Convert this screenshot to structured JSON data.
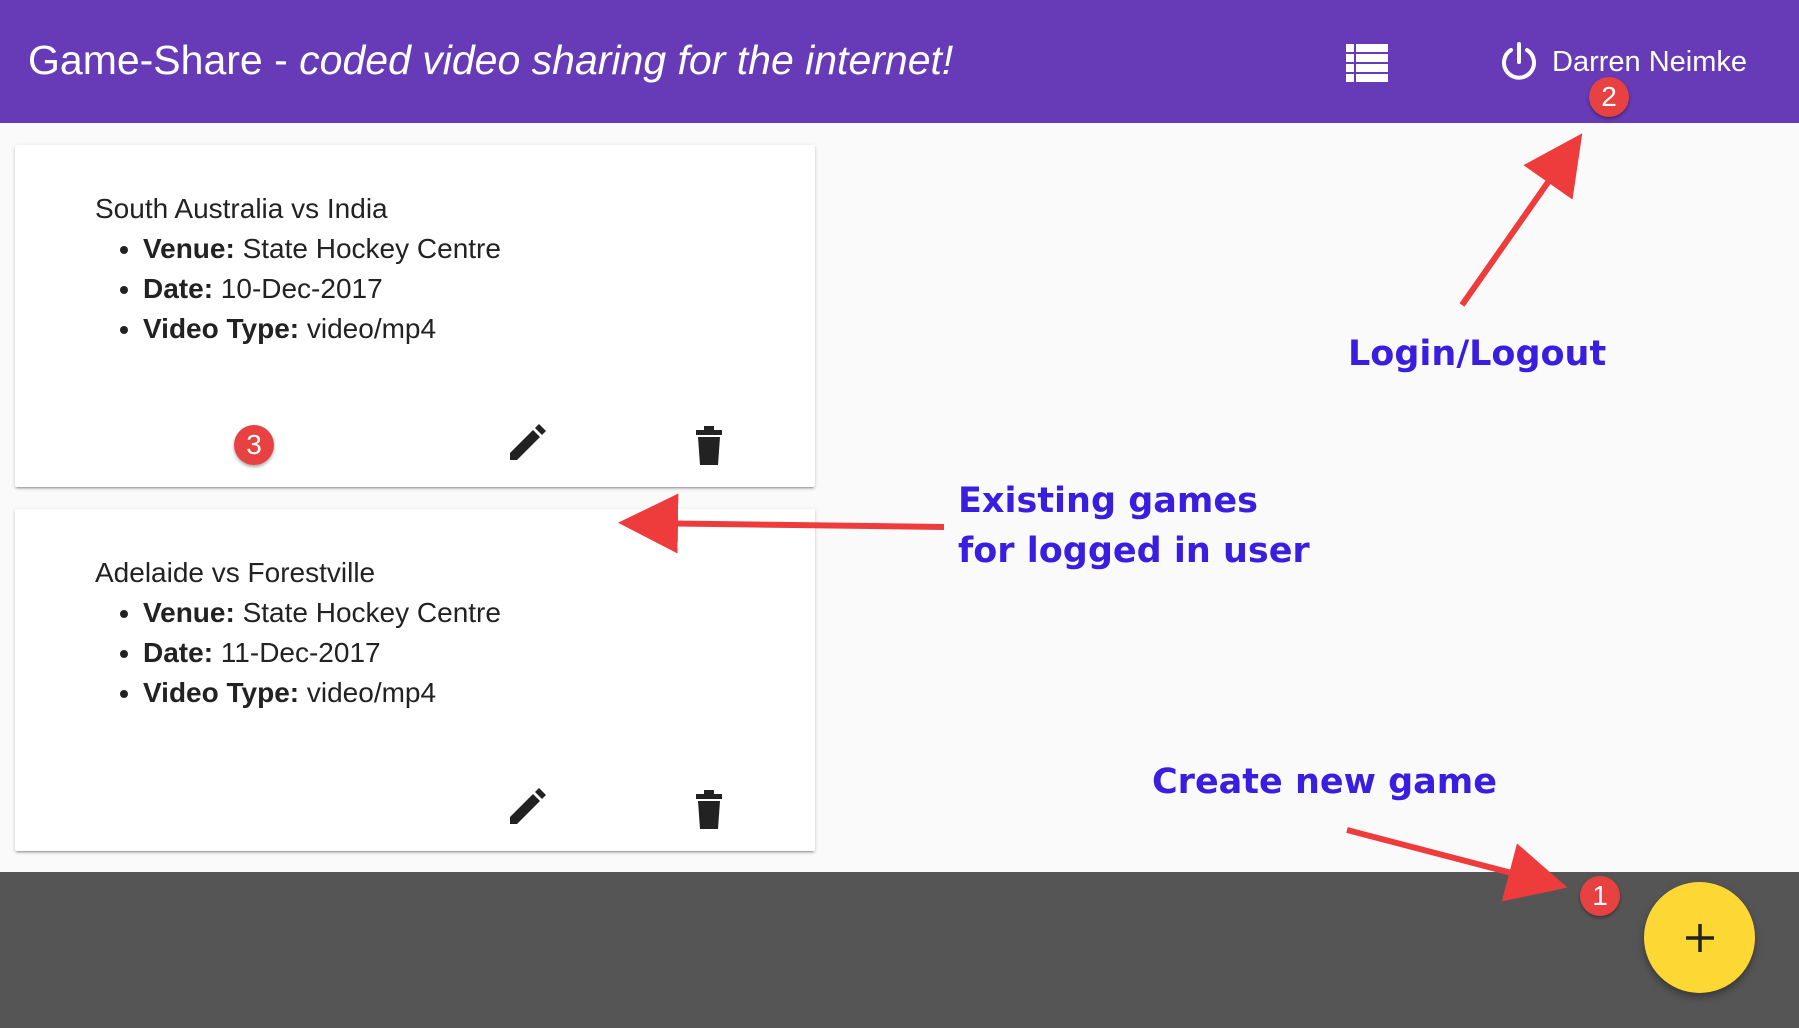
{
  "app": {
    "title_prefix": "Game-Share - ",
    "title_tagline": "coded video sharing for the internet!",
    "user_name": "Darren Neimke",
    "icons": [
      "list-icon",
      "power-icon",
      "edit-icon",
      "delete-icon",
      "add-icon"
    ],
    "colors": {
      "toolbar": "#673ab7",
      "fab": "#fdd835",
      "footer": "#555555",
      "badge": "#e84141",
      "callout": "#3a1ee0"
    }
  },
  "labels": {
    "venue": "Venue:",
    "date": "Date:",
    "video_type": "Video Type:"
  },
  "games": [
    {
      "title": "South Australia vs India",
      "venue": "State Hockey Centre",
      "date": "10-Dec-2017",
      "video_type": "video/mp4"
    },
    {
      "title": "Adelaide vs Forestville",
      "venue": "State Hockey Centre",
      "date": "11-Dec-2017",
      "video_type": "video/mp4"
    }
  ],
  "fab": {
    "symbol": "+"
  },
  "annotations": {
    "badges": [
      "1",
      "2",
      "3"
    ],
    "login_logout": "Login/Logout",
    "existing_games_line1": "Existing games",
    "existing_games_line2": "for logged in user",
    "create_new_game": "Create new game"
  }
}
